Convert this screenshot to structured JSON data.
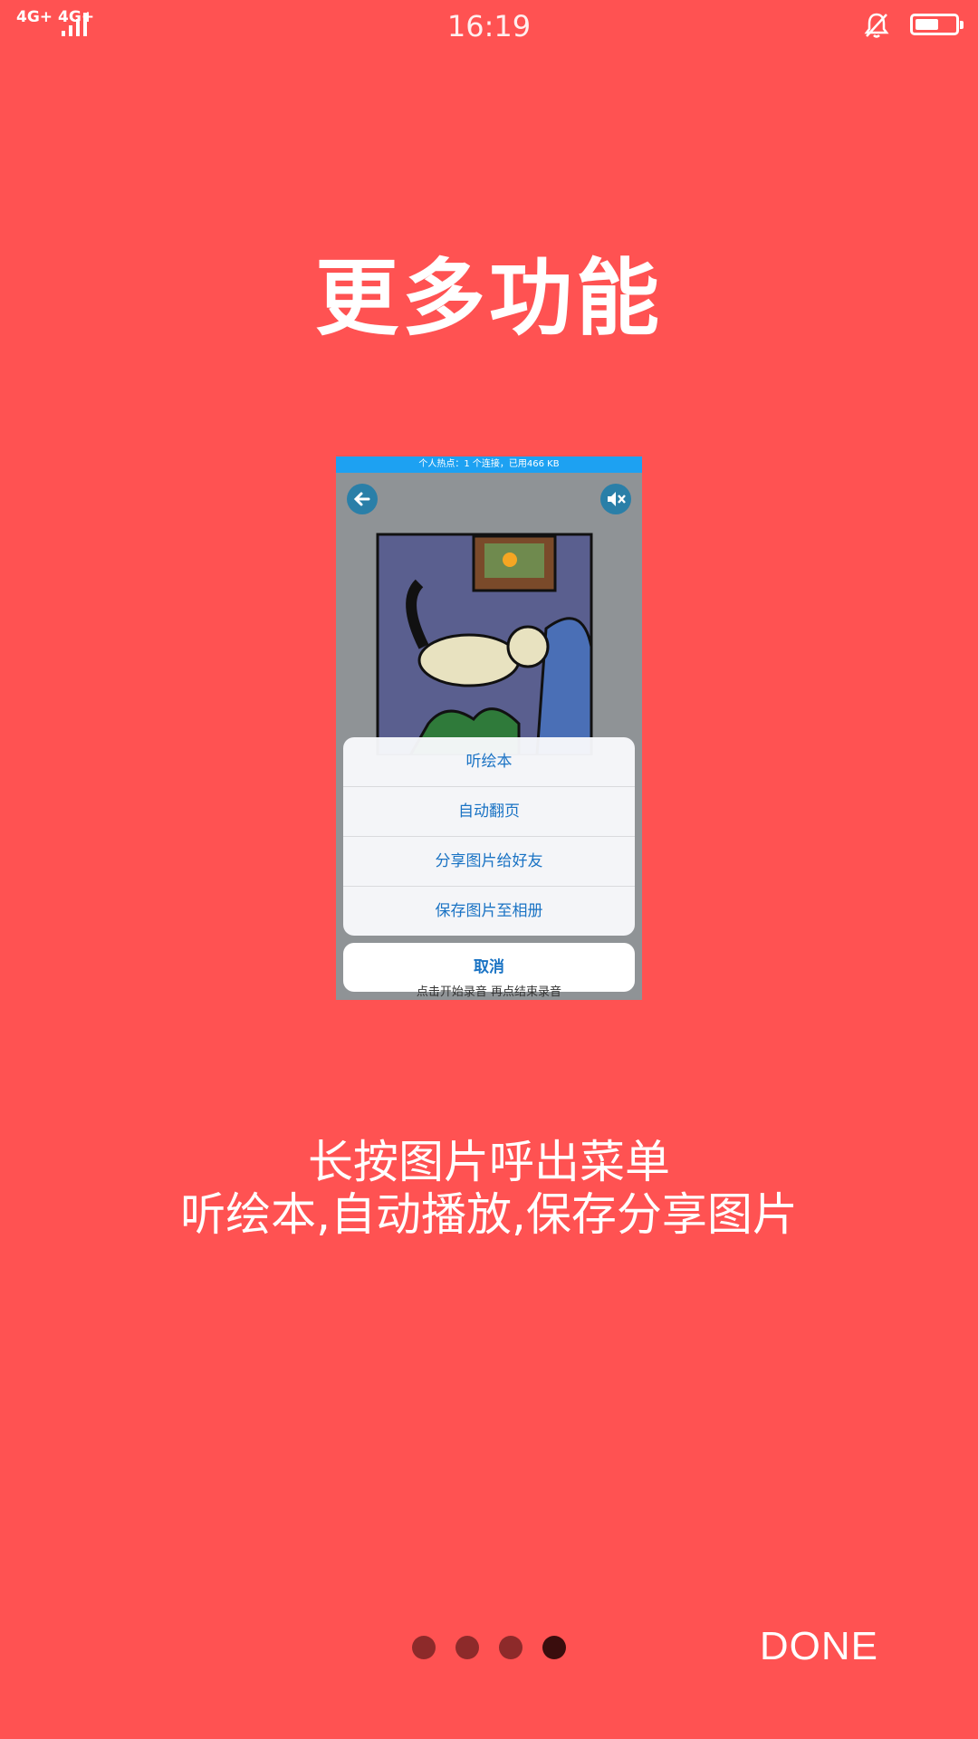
{
  "status_bar": {
    "network_1": "4G+",
    "network_2": "4G+",
    "time": "16:19",
    "bell_icon": "bell-muted-icon",
    "battery_icon": "battery-icon"
  },
  "title": "更多功能",
  "preview": {
    "hotspot_text": "个人热点：1 个连接，已用466 KB",
    "back_icon": "back-arrow-icon",
    "mute_icon": "mute-icon",
    "menu_items": [
      "听绘本",
      "自动翻页",
      "分享图片给好友",
      "保存图片至相册"
    ],
    "cancel_label": "取消",
    "caption": "点击开始录音 再点结束录音"
  },
  "description": {
    "line1": "长按图片呼出菜单",
    "line2": "听绘本,自动播放,保存分享图片"
  },
  "pager": {
    "count": 4,
    "active_index": 3
  },
  "done_label": "DONE",
  "colors": {
    "background": "#FF5252",
    "dot": "#8d2a2a",
    "dot_active": "#3a0d0d",
    "accent": "#1a73c4"
  }
}
